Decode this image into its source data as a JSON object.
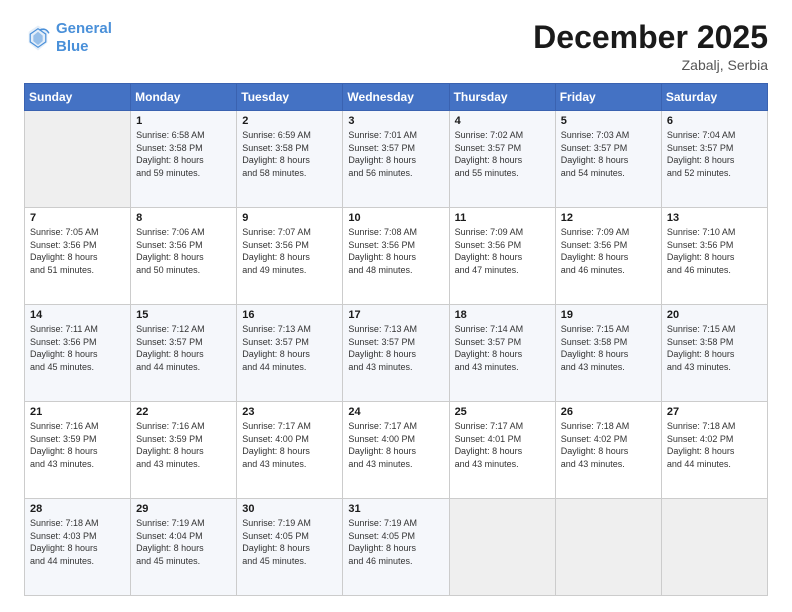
{
  "header": {
    "logo_line1": "General",
    "logo_line2": "Blue",
    "month": "December 2025",
    "location": "Zabalj, Serbia"
  },
  "days_of_week": [
    "Sunday",
    "Monday",
    "Tuesday",
    "Wednesday",
    "Thursday",
    "Friday",
    "Saturday"
  ],
  "weeks": [
    [
      {
        "day": "",
        "info": ""
      },
      {
        "day": "1",
        "info": "Sunrise: 6:58 AM\nSunset: 3:58 PM\nDaylight: 8 hours\nand 59 minutes."
      },
      {
        "day": "2",
        "info": "Sunrise: 6:59 AM\nSunset: 3:58 PM\nDaylight: 8 hours\nand 58 minutes."
      },
      {
        "day": "3",
        "info": "Sunrise: 7:01 AM\nSunset: 3:57 PM\nDaylight: 8 hours\nand 56 minutes."
      },
      {
        "day": "4",
        "info": "Sunrise: 7:02 AM\nSunset: 3:57 PM\nDaylight: 8 hours\nand 55 minutes."
      },
      {
        "day": "5",
        "info": "Sunrise: 7:03 AM\nSunset: 3:57 PM\nDaylight: 8 hours\nand 54 minutes."
      },
      {
        "day": "6",
        "info": "Sunrise: 7:04 AM\nSunset: 3:57 PM\nDaylight: 8 hours\nand 52 minutes."
      }
    ],
    [
      {
        "day": "7",
        "info": "Sunrise: 7:05 AM\nSunset: 3:56 PM\nDaylight: 8 hours\nand 51 minutes."
      },
      {
        "day": "8",
        "info": "Sunrise: 7:06 AM\nSunset: 3:56 PM\nDaylight: 8 hours\nand 50 minutes."
      },
      {
        "day": "9",
        "info": "Sunrise: 7:07 AM\nSunset: 3:56 PM\nDaylight: 8 hours\nand 49 minutes."
      },
      {
        "day": "10",
        "info": "Sunrise: 7:08 AM\nSunset: 3:56 PM\nDaylight: 8 hours\nand 48 minutes."
      },
      {
        "day": "11",
        "info": "Sunrise: 7:09 AM\nSunset: 3:56 PM\nDaylight: 8 hours\nand 47 minutes."
      },
      {
        "day": "12",
        "info": "Sunrise: 7:09 AM\nSunset: 3:56 PM\nDaylight: 8 hours\nand 46 minutes."
      },
      {
        "day": "13",
        "info": "Sunrise: 7:10 AM\nSunset: 3:56 PM\nDaylight: 8 hours\nand 46 minutes."
      }
    ],
    [
      {
        "day": "14",
        "info": "Sunrise: 7:11 AM\nSunset: 3:56 PM\nDaylight: 8 hours\nand 45 minutes."
      },
      {
        "day": "15",
        "info": "Sunrise: 7:12 AM\nSunset: 3:57 PM\nDaylight: 8 hours\nand 44 minutes."
      },
      {
        "day": "16",
        "info": "Sunrise: 7:13 AM\nSunset: 3:57 PM\nDaylight: 8 hours\nand 44 minutes."
      },
      {
        "day": "17",
        "info": "Sunrise: 7:13 AM\nSunset: 3:57 PM\nDaylight: 8 hours\nand 43 minutes."
      },
      {
        "day": "18",
        "info": "Sunrise: 7:14 AM\nSunset: 3:57 PM\nDaylight: 8 hours\nand 43 minutes."
      },
      {
        "day": "19",
        "info": "Sunrise: 7:15 AM\nSunset: 3:58 PM\nDaylight: 8 hours\nand 43 minutes."
      },
      {
        "day": "20",
        "info": "Sunrise: 7:15 AM\nSunset: 3:58 PM\nDaylight: 8 hours\nand 43 minutes."
      }
    ],
    [
      {
        "day": "21",
        "info": "Sunrise: 7:16 AM\nSunset: 3:59 PM\nDaylight: 8 hours\nand 43 minutes."
      },
      {
        "day": "22",
        "info": "Sunrise: 7:16 AM\nSunset: 3:59 PM\nDaylight: 8 hours\nand 43 minutes."
      },
      {
        "day": "23",
        "info": "Sunrise: 7:17 AM\nSunset: 4:00 PM\nDaylight: 8 hours\nand 43 minutes."
      },
      {
        "day": "24",
        "info": "Sunrise: 7:17 AM\nSunset: 4:00 PM\nDaylight: 8 hours\nand 43 minutes."
      },
      {
        "day": "25",
        "info": "Sunrise: 7:17 AM\nSunset: 4:01 PM\nDaylight: 8 hours\nand 43 minutes."
      },
      {
        "day": "26",
        "info": "Sunrise: 7:18 AM\nSunset: 4:02 PM\nDaylight: 8 hours\nand 43 minutes."
      },
      {
        "day": "27",
        "info": "Sunrise: 7:18 AM\nSunset: 4:02 PM\nDaylight: 8 hours\nand 44 minutes."
      }
    ],
    [
      {
        "day": "28",
        "info": "Sunrise: 7:18 AM\nSunset: 4:03 PM\nDaylight: 8 hours\nand 44 minutes."
      },
      {
        "day": "29",
        "info": "Sunrise: 7:19 AM\nSunset: 4:04 PM\nDaylight: 8 hours\nand 45 minutes."
      },
      {
        "day": "30",
        "info": "Sunrise: 7:19 AM\nSunset: 4:05 PM\nDaylight: 8 hours\nand 45 minutes."
      },
      {
        "day": "31",
        "info": "Sunrise: 7:19 AM\nSunset: 4:05 PM\nDaylight: 8 hours\nand 46 minutes."
      },
      {
        "day": "",
        "info": ""
      },
      {
        "day": "",
        "info": ""
      },
      {
        "day": "",
        "info": ""
      }
    ]
  ]
}
